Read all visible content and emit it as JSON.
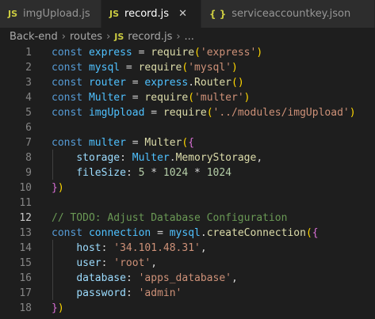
{
  "tabs": [
    {
      "icon": "JS",
      "label": "imgUpload.js",
      "active": false
    },
    {
      "icon": "JS",
      "label": "record.js",
      "active": true,
      "close": "✕"
    },
    {
      "icon": "{ }",
      "label": "serviceaccountkey.json",
      "active": false
    }
  ],
  "breadcrumb": {
    "folder1": "Back-end",
    "folder2": "routes",
    "file_icon": "JS",
    "file": "record.js",
    "more": "..."
  },
  "editor": {
    "line_numbers": [
      "1",
      "2",
      "3",
      "4",
      "5",
      "6",
      "7",
      "8",
      "9",
      "10",
      "11",
      "12",
      "13",
      "14",
      "15",
      "16",
      "17",
      "18"
    ],
    "current_line": 12,
    "lines": [
      [
        [
          "kw",
          "const "
        ],
        [
          "var",
          "express"
        ],
        [
          "p",
          " = "
        ],
        [
          "fn",
          "require"
        ],
        [
          "br1",
          "("
        ],
        [
          "str",
          "'express'"
        ],
        [
          "br1",
          ")"
        ]
      ],
      [
        [
          "kw",
          "const "
        ],
        [
          "var",
          "mysql"
        ],
        [
          "p",
          " = "
        ],
        [
          "fn",
          "require"
        ],
        [
          "br1",
          "("
        ],
        [
          "str",
          "'mysql'"
        ],
        [
          "br1",
          ")"
        ]
      ],
      [
        [
          "kw",
          "const "
        ],
        [
          "var",
          "router"
        ],
        [
          "p",
          " = "
        ],
        [
          "var",
          "express"
        ],
        [
          "p",
          "."
        ],
        [
          "fn",
          "Router"
        ],
        [
          "br1",
          "()"
        ]
      ],
      [
        [
          "kw",
          "const "
        ],
        [
          "var",
          "Multer"
        ],
        [
          "p",
          " = "
        ],
        [
          "fn",
          "require"
        ],
        [
          "br1",
          "("
        ],
        [
          "str",
          "'multer'"
        ],
        [
          "br1",
          ")"
        ]
      ],
      [
        [
          "kw",
          "const "
        ],
        [
          "var",
          "imgUpload"
        ],
        [
          "p",
          " = "
        ],
        [
          "fn",
          "require"
        ],
        [
          "br1",
          "("
        ],
        [
          "str",
          "'../modules/imgUpload'"
        ],
        [
          "br1",
          ")"
        ]
      ],
      [],
      [
        [
          "kw",
          "const "
        ],
        [
          "var",
          "multer"
        ],
        [
          "p",
          " = "
        ],
        [
          "fn",
          "Multer"
        ],
        [
          "br1",
          "("
        ],
        [
          "br2",
          "{"
        ]
      ],
      [
        [
          "p",
          "    "
        ],
        [
          "prop",
          "storage"
        ],
        [
          "p",
          ": "
        ],
        [
          "var",
          "Multer"
        ],
        [
          "p",
          "."
        ],
        [
          "fn",
          "MemoryStorage"
        ],
        [
          "p",
          ","
        ]
      ],
      [
        [
          "p",
          "    "
        ],
        [
          "prop",
          "fileSize"
        ],
        [
          "p",
          ": "
        ],
        [
          "num",
          "5"
        ],
        [
          "p",
          " * "
        ],
        [
          "num",
          "1024"
        ],
        [
          "p",
          " * "
        ],
        [
          "num",
          "1024"
        ]
      ],
      [
        [
          "br2",
          "}"
        ],
        [
          "br1",
          ")"
        ]
      ],
      [],
      [
        [
          "cmt",
          "// TODO: Adjust Database Configuration"
        ]
      ],
      [
        [
          "kw",
          "const "
        ],
        [
          "var",
          "connection"
        ],
        [
          "p",
          " = "
        ],
        [
          "var",
          "mysql"
        ],
        [
          "p",
          "."
        ],
        [
          "fn",
          "createConnection"
        ],
        [
          "br1",
          "("
        ],
        [
          "br2",
          "{"
        ]
      ],
      [
        [
          "p",
          "    "
        ],
        [
          "prop",
          "host"
        ],
        [
          "p",
          ": "
        ],
        [
          "str",
          "'34.101.48.31'"
        ],
        [
          "p",
          ","
        ]
      ],
      [
        [
          "p",
          "    "
        ],
        [
          "prop",
          "user"
        ],
        [
          "p",
          ": "
        ],
        [
          "str",
          "'root'"
        ],
        [
          "p",
          ","
        ]
      ],
      [
        [
          "p",
          "    "
        ],
        [
          "prop",
          "database"
        ],
        [
          "p",
          ": "
        ],
        [
          "str",
          "'apps_database'"
        ],
        [
          "p",
          ","
        ]
      ],
      [
        [
          "p",
          "    "
        ],
        [
          "prop",
          "password"
        ],
        [
          "p",
          ": "
        ],
        [
          "str",
          "'admin'"
        ]
      ],
      [
        [
          "br2",
          "}"
        ],
        [
          "br1",
          ")"
        ]
      ]
    ]
  }
}
